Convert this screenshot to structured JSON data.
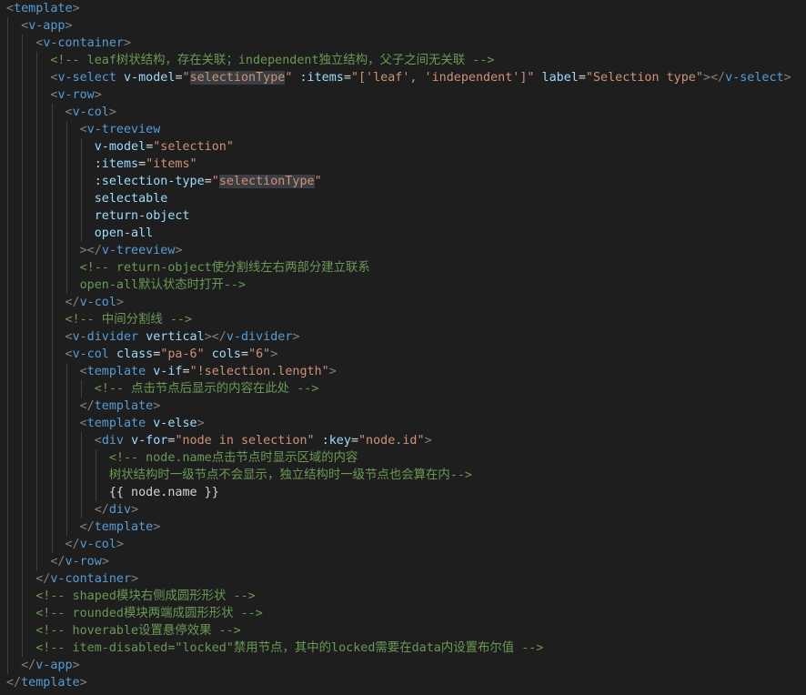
{
  "editor": {
    "language": "vue-html",
    "colors": {
      "background": "#1e1e1e",
      "punctuation": "#808080",
      "tag": "#569cd6",
      "attribute": "#9cdcfe",
      "string": "#ce9178",
      "comment": "#6a9955",
      "text": "#d4d4d4",
      "highlight": "#3a3d41"
    },
    "lines": [
      {
        "indent": 0,
        "tokens": [
          {
            "t": "punct",
            "v": "<"
          },
          {
            "t": "tag",
            "v": "template"
          },
          {
            "t": "punct",
            "v": ">"
          }
        ]
      },
      {
        "indent": 1,
        "tokens": [
          {
            "t": "punct",
            "v": "<"
          },
          {
            "t": "tag",
            "v": "v-app"
          },
          {
            "t": "punct",
            "v": ">"
          }
        ]
      },
      {
        "indent": 2,
        "tokens": [
          {
            "t": "punct",
            "v": "<"
          },
          {
            "t": "tag",
            "v": "v-container"
          },
          {
            "t": "punct",
            "v": ">"
          }
        ]
      },
      {
        "indent": 3,
        "tokens": [
          {
            "t": "comment",
            "v": "<!-- leaf树状结构，存在关联；independent独立结构，父子之间无关联 -->"
          }
        ]
      },
      {
        "indent": 3,
        "tokens": [
          {
            "t": "punct",
            "v": "<"
          },
          {
            "t": "tag",
            "v": "v-select"
          },
          {
            "t": "text",
            "v": " "
          },
          {
            "t": "attr",
            "v": "v-model"
          },
          {
            "t": "eq",
            "v": "="
          },
          {
            "t": "str",
            "v": "\""
          },
          {
            "t": "str",
            "v": "selectionType",
            "hl": true
          },
          {
            "t": "str",
            "v": "\""
          },
          {
            "t": "text",
            "v": " "
          },
          {
            "t": "attr",
            "v": ":items"
          },
          {
            "t": "eq",
            "v": "="
          },
          {
            "t": "str",
            "v": "\"['leaf', 'independent']\""
          },
          {
            "t": "text",
            "v": " "
          },
          {
            "t": "attr",
            "v": "label"
          },
          {
            "t": "eq",
            "v": "="
          },
          {
            "t": "str",
            "v": "\"Selection type\""
          },
          {
            "t": "punct",
            "v": "></"
          },
          {
            "t": "tag",
            "v": "v-select"
          },
          {
            "t": "punct",
            "v": ">"
          }
        ]
      },
      {
        "indent": 3,
        "tokens": [
          {
            "t": "punct",
            "v": "<"
          },
          {
            "t": "tag",
            "v": "v-row"
          },
          {
            "t": "punct",
            "v": ">"
          }
        ]
      },
      {
        "indent": 4,
        "tokens": [
          {
            "t": "punct",
            "v": "<"
          },
          {
            "t": "tag",
            "v": "v-col"
          },
          {
            "t": "punct",
            "v": ">"
          }
        ]
      },
      {
        "indent": 5,
        "tokens": [
          {
            "t": "punct",
            "v": "<"
          },
          {
            "t": "tag",
            "v": "v-treeview"
          }
        ]
      },
      {
        "indent": 6,
        "tokens": [
          {
            "t": "attr",
            "v": "v-model"
          },
          {
            "t": "eq",
            "v": "="
          },
          {
            "t": "str",
            "v": "\"selection\""
          }
        ]
      },
      {
        "indent": 6,
        "tokens": [
          {
            "t": "attr",
            "v": ":items"
          },
          {
            "t": "eq",
            "v": "="
          },
          {
            "t": "str",
            "v": "\"items\""
          }
        ]
      },
      {
        "indent": 6,
        "tokens": [
          {
            "t": "attr",
            "v": ":selection-type"
          },
          {
            "t": "eq",
            "v": "="
          },
          {
            "t": "str",
            "v": "\""
          },
          {
            "t": "str",
            "v": "selectionType",
            "hl": true
          },
          {
            "t": "str",
            "v": "\""
          }
        ]
      },
      {
        "indent": 6,
        "tokens": [
          {
            "t": "attr",
            "v": "selectable"
          }
        ]
      },
      {
        "indent": 6,
        "tokens": [
          {
            "t": "attr",
            "v": "return-object"
          }
        ]
      },
      {
        "indent": 6,
        "tokens": [
          {
            "t": "attr",
            "v": "open-all"
          }
        ]
      },
      {
        "indent": 5,
        "tokens": [
          {
            "t": "punct",
            "v": "></"
          },
          {
            "t": "tag",
            "v": "v-treeview"
          },
          {
            "t": "punct",
            "v": ">"
          }
        ]
      },
      {
        "indent": 5,
        "tokens": [
          {
            "t": "comment",
            "v": "<!-- return-object使分割线左右两部分建立联系"
          }
        ]
      },
      {
        "indent": 5,
        "tokens": [
          {
            "t": "comment",
            "v": "open-all默认状态时打开-->"
          }
        ]
      },
      {
        "indent": 4,
        "tokens": [
          {
            "t": "punct",
            "v": "</"
          },
          {
            "t": "tag",
            "v": "v-col"
          },
          {
            "t": "punct",
            "v": ">"
          }
        ]
      },
      {
        "indent": 4,
        "tokens": [
          {
            "t": "comment",
            "v": "<!-- 中间分割线 -->"
          }
        ]
      },
      {
        "indent": 4,
        "tokens": [
          {
            "t": "punct",
            "v": "<"
          },
          {
            "t": "tag",
            "v": "v-divider"
          },
          {
            "t": "text",
            "v": " "
          },
          {
            "t": "attr",
            "v": "vertical"
          },
          {
            "t": "punct",
            "v": "></"
          },
          {
            "t": "tag",
            "v": "v-divider"
          },
          {
            "t": "punct",
            "v": ">"
          }
        ]
      },
      {
        "indent": 4,
        "tokens": [
          {
            "t": "punct",
            "v": "<"
          },
          {
            "t": "tag",
            "v": "v-col"
          },
          {
            "t": "text",
            "v": " "
          },
          {
            "t": "attr",
            "v": "class"
          },
          {
            "t": "eq",
            "v": "="
          },
          {
            "t": "str",
            "v": "\"pa-6\""
          },
          {
            "t": "text",
            "v": " "
          },
          {
            "t": "attr",
            "v": "cols"
          },
          {
            "t": "eq",
            "v": "="
          },
          {
            "t": "str",
            "v": "\"6\""
          },
          {
            "t": "punct",
            "v": ">"
          }
        ]
      },
      {
        "indent": 5,
        "tokens": [
          {
            "t": "punct",
            "v": "<"
          },
          {
            "t": "tag",
            "v": "template"
          },
          {
            "t": "text",
            "v": " "
          },
          {
            "t": "attr",
            "v": "v-if"
          },
          {
            "t": "eq",
            "v": "="
          },
          {
            "t": "str",
            "v": "\"!selection.length\""
          },
          {
            "t": "punct",
            "v": ">"
          }
        ]
      },
      {
        "indent": 6,
        "tokens": [
          {
            "t": "comment",
            "v": "<!-- 点击节点后显示的内容在此处 -->"
          }
        ]
      },
      {
        "indent": 5,
        "tokens": [
          {
            "t": "punct",
            "v": "</"
          },
          {
            "t": "tag",
            "v": "template"
          },
          {
            "t": "punct",
            "v": ">"
          }
        ]
      },
      {
        "indent": 5,
        "tokens": [
          {
            "t": "punct",
            "v": "<"
          },
          {
            "t": "tag",
            "v": "template"
          },
          {
            "t": "text",
            "v": " "
          },
          {
            "t": "attr",
            "v": "v-else"
          },
          {
            "t": "punct",
            "v": ">"
          }
        ]
      },
      {
        "indent": 6,
        "tokens": [
          {
            "t": "punct",
            "v": "<"
          },
          {
            "t": "tag",
            "v": "div"
          },
          {
            "t": "text",
            "v": " "
          },
          {
            "t": "attr",
            "v": "v-for"
          },
          {
            "t": "eq",
            "v": "="
          },
          {
            "t": "str",
            "v": "\"node in selection\""
          },
          {
            "t": "text",
            "v": " "
          },
          {
            "t": "attr",
            "v": ":key"
          },
          {
            "t": "eq",
            "v": "="
          },
          {
            "t": "str",
            "v": "\"node.id\""
          },
          {
            "t": "punct",
            "v": ">"
          }
        ]
      },
      {
        "indent": 7,
        "tokens": [
          {
            "t": "comment",
            "v": "<!-- node.name点击节点时显示区域的内容"
          }
        ]
      },
      {
        "indent": 7,
        "tokens": [
          {
            "t": "comment",
            "v": "树状结构时一级节点不会显示，独立结构时一级节点也会算在内-->"
          }
        ]
      },
      {
        "indent": 7,
        "tokens": [
          {
            "t": "text",
            "v": "{{ node.name }}"
          }
        ]
      },
      {
        "indent": 6,
        "tokens": [
          {
            "t": "punct",
            "v": "</"
          },
          {
            "t": "tag",
            "v": "div"
          },
          {
            "t": "punct",
            "v": ">"
          }
        ]
      },
      {
        "indent": 5,
        "tokens": [
          {
            "t": "punct",
            "v": "</"
          },
          {
            "t": "tag",
            "v": "template"
          },
          {
            "t": "punct",
            "v": ">"
          }
        ]
      },
      {
        "indent": 4,
        "tokens": [
          {
            "t": "punct",
            "v": "</"
          },
          {
            "t": "tag",
            "v": "v-col"
          },
          {
            "t": "punct",
            "v": ">"
          }
        ]
      },
      {
        "indent": 3,
        "tokens": [
          {
            "t": "punct",
            "v": "</"
          },
          {
            "t": "tag",
            "v": "v-row"
          },
          {
            "t": "punct",
            "v": ">"
          }
        ]
      },
      {
        "indent": 2,
        "tokens": [
          {
            "t": "punct",
            "v": "</"
          },
          {
            "t": "tag",
            "v": "v-container"
          },
          {
            "t": "punct",
            "v": ">"
          }
        ]
      },
      {
        "indent": 2,
        "tokens": [
          {
            "t": "comment",
            "v": "<!-- shaped模块右侧成圆形形状 -->"
          }
        ]
      },
      {
        "indent": 2,
        "tokens": [
          {
            "t": "comment",
            "v": "<!-- rounded模块两端成圆形形状 -->"
          }
        ]
      },
      {
        "indent": 2,
        "tokens": [
          {
            "t": "comment",
            "v": "<!-- hoverable设置悬停效果 -->"
          }
        ]
      },
      {
        "indent": 2,
        "tokens": [
          {
            "t": "comment",
            "v": "<!-- item-disabled=\"locked\"禁用节点，其中的locked需要在data内设置布尔值 -->"
          }
        ]
      },
      {
        "indent": 1,
        "tokens": [
          {
            "t": "punct",
            "v": "</"
          },
          {
            "t": "tag",
            "v": "v-app"
          },
          {
            "t": "punct",
            "v": ">"
          }
        ]
      },
      {
        "indent": 0,
        "tokens": [
          {
            "t": "punct",
            "v": "</"
          },
          {
            "t": "tag",
            "v": "template"
          },
          {
            "t": "punct",
            "v": ">"
          }
        ]
      }
    ]
  }
}
